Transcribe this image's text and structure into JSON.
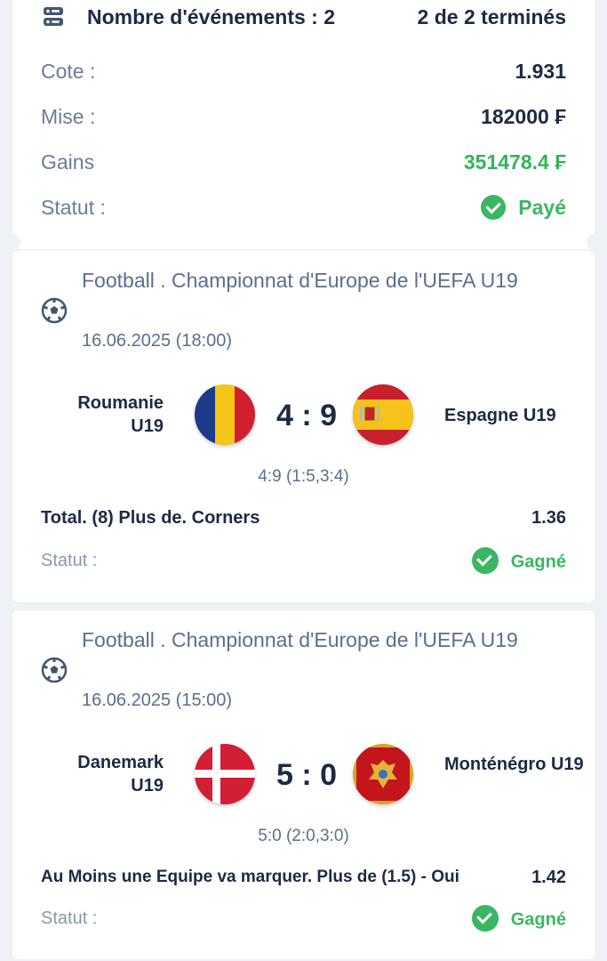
{
  "summary": {
    "events_label": "Nombre d'événements : 2",
    "completed": "2 de 2 terminés",
    "rows": [
      {
        "label": "Cote :",
        "value": "1.931"
      },
      {
        "label": "Mise :",
        "value": "182000 ₣"
      },
      {
        "label": "Gains",
        "value": "351478.4 ₣"
      },
      {
        "label": "Statut :",
        "value": "Payé"
      }
    ],
    "icon": "list-icon"
  },
  "events": [
    {
      "title": "Football . Championnat d'Europe de l'UEFA U19",
      "date": "16.06.2025 (18:00)",
      "team_home": "Roumanie U19",
      "team_away": "Espagne U19",
      "score": "4 : 9",
      "half_scores": "4:9 (1:5,3:4)",
      "bet": "Total. (8) Plus de. Corners",
      "odds": "1.36",
      "status_label": "Statut :",
      "status": "Gagné"
    },
    {
      "title": "Football . Championnat d'Europe de l'UEFA U19",
      "date": "16.06.2025 (15:00)",
      "team_home": "Danemark U19",
      "team_away": "Monténégro U19",
      "score": "5 : 0",
      "half_scores": "5:0 (2:0,3:0)",
      "bet": "Au Moins une Equipe va marquer. Plus de (1.5) - Oui",
      "odds": "1.42",
      "status_label": "Statut :",
      "status": "Gagné"
    }
  ],
  "colors": {
    "accent_green": "#3bb662",
    "text_dark": "#1c2a44",
    "text_muted": "#5a6f8e"
  }
}
